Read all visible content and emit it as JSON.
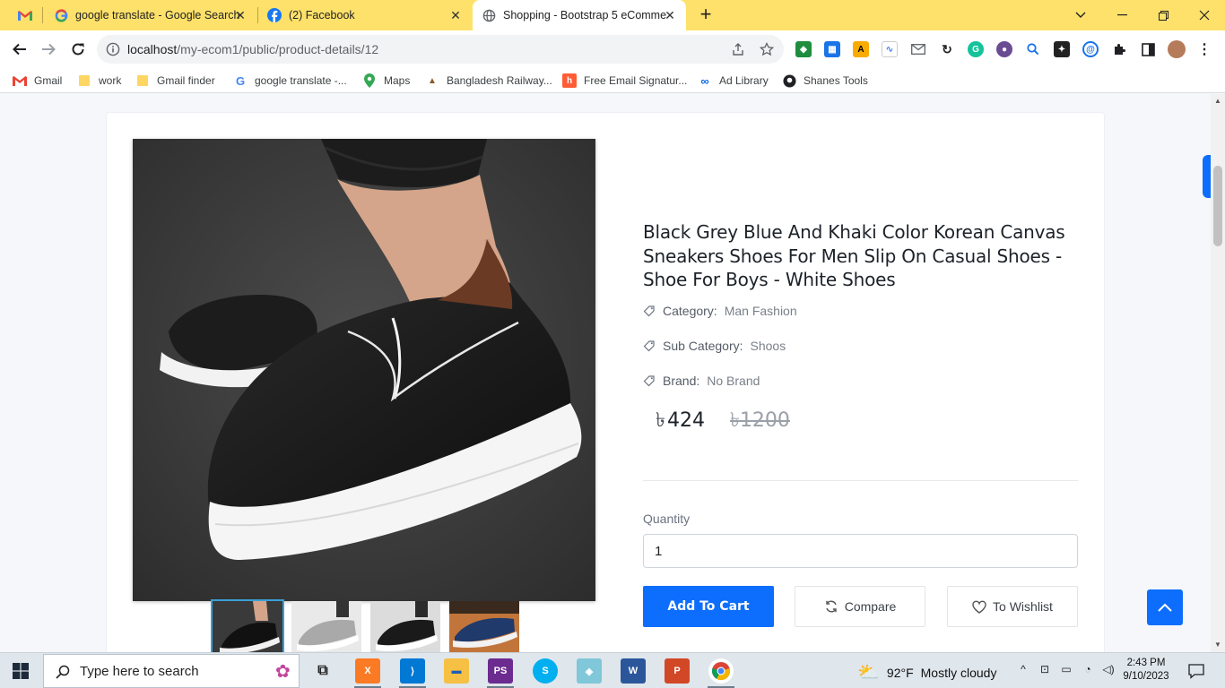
{
  "tabs": [
    {
      "title": "",
      "icon": "gmail-icon",
      "active": false
    },
    {
      "title": "google translate - Google Search",
      "icon": "google-icon",
      "active": false
    },
    {
      "title": "(2) Facebook",
      "icon": "facebook-icon",
      "active": false
    },
    {
      "title": "Shopping - Bootstrap 5 eComme",
      "icon": "globe-icon",
      "active": true
    }
  ],
  "address": {
    "host": "localhost",
    "path": "/my-ecom1/public/product-details/12"
  },
  "bookmarks": [
    {
      "label": "Gmail",
      "icon": "gmail-icon"
    },
    {
      "label": "work",
      "icon": "folder-icon"
    },
    {
      "label": "Gmail  finder",
      "icon": "folder-icon"
    },
    {
      "label": "google translate -...",
      "icon": "google-icon"
    },
    {
      "label": "Maps",
      "icon": "maps-pin-icon"
    },
    {
      "label": "Bangladesh Railway...",
      "icon": "railway-icon"
    },
    {
      "label": "Free Email Signatur...",
      "icon": "hubspot-icon"
    },
    {
      "label": "Ad Library",
      "icon": "meta-icon"
    },
    {
      "label": "Shanes Tools",
      "icon": "github-icon"
    }
  ],
  "product": {
    "title": "Black Grey Blue And Khaki Color Korean Canvas Sneakers Shoes For Men Slip On Casual Shoes - Shoe For Boys - White Shoes",
    "category_label": "Category:",
    "category": "Man Fashion",
    "subcategory_label": "Sub Category:",
    "subcategory": "Shoos",
    "brand_label": "Brand:",
    "brand": "No Brand",
    "currency": "৳",
    "price": "424",
    "old_price": "1200",
    "quantity_label": "Quantity",
    "quantity": "1",
    "add_to_cart": "Add To Cart",
    "compare": "Compare",
    "wishlist": "To Wishlist"
  },
  "taskbar": {
    "search_placeholder": "Type here to search",
    "weather_temp": "92°F",
    "weather_text": "Mostly cloudy",
    "time": "2:43 PM",
    "date": "9/10/2023"
  },
  "colors": {
    "tabstrip": "#fde16a",
    "primary": "#0d6efd"
  }
}
